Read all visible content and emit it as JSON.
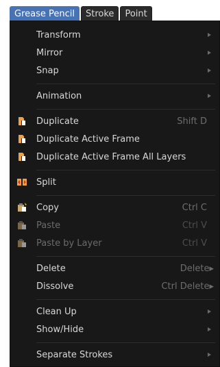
{
  "tabs": [
    "Grease Pencil",
    "Stroke",
    "Point"
  ],
  "menu": {
    "transform": "Transform",
    "mirror": "Mirror",
    "snap": "Snap",
    "animation": "Animation",
    "duplicate": "Duplicate",
    "duplicate_shortcut": "Shift D",
    "duplicate_active_frame": "Duplicate Active Frame",
    "duplicate_active_frame_all": "Duplicate Active Frame All Layers",
    "split": "Split",
    "copy": "Copy",
    "copy_shortcut": "Ctrl C",
    "paste": "Paste",
    "paste_shortcut": "Ctrl V",
    "paste_by_layer": "Paste by Layer",
    "paste_by_layer_shortcut": "Ctrl V",
    "delete": "Delete",
    "delete_shortcut": "Delete▸",
    "dissolve": "Dissolve",
    "dissolve_shortcut": "Ctrl Delete▸",
    "clean_up": "Clean Up",
    "show_hide": "Show/Hide",
    "separate_strokes": "Separate Strokes"
  },
  "colors": {
    "accent": "#4772b3",
    "menu_bg": "#181818",
    "icon_orange": "#f0a040",
    "icon_red": "#e03020"
  }
}
